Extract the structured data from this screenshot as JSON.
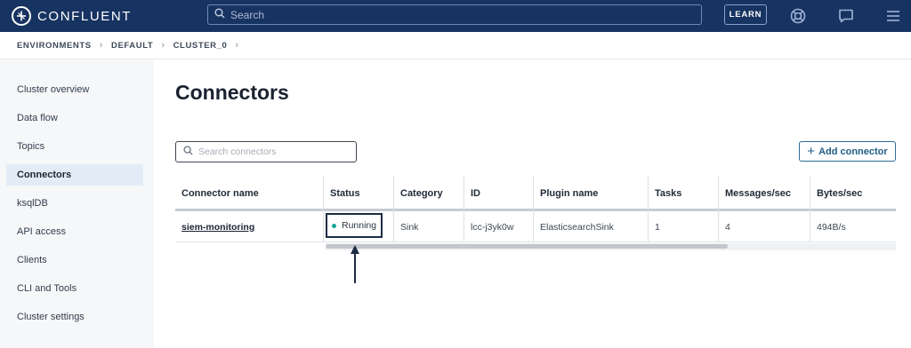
{
  "app": {
    "brand": "CONFLUENT",
    "search_placeholder": "Search",
    "learn_label": "LEARN"
  },
  "breadcrumb": [
    "ENVIRONMENTS",
    "DEFAULT",
    "CLUSTER_0"
  ],
  "sidebar": {
    "items": [
      {
        "label": "Cluster overview"
      },
      {
        "label": "Data flow"
      },
      {
        "label": "Topics"
      },
      {
        "label": "Connectors",
        "active": true
      },
      {
        "label": "ksqlDB"
      },
      {
        "label": "API access"
      },
      {
        "label": "Clients"
      },
      {
        "label": "CLI and Tools"
      },
      {
        "label": "Cluster settings"
      }
    ]
  },
  "main": {
    "title": "Connectors",
    "search_placeholder": "Search connectors",
    "add_label": "Add connector"
  },
  "table": {
    "columns": [
      "Connector name",
      "Status",
      "Category",
      "ID",
      "Plugin name",
      "Tasks",
      "Messages/sec",
      "Bytes/sec"
    ],
    "rows": [
      {
        "name": "siem-monitoring",
        "status": "Running",
        "category": "Sink",
        "id": "lcc-j3yk0w",
        "plugin": "ElasticsearchSink",
        "tasks": "1",
        "messages": "4",
        "bytes": "494B/s"
      }
    ]
  },
  "colors": {
    "topbar": "#173361",
    "status_running": "#1aa39a",
    "accent": "#1f5d86"
  },
  "icons": [
    "confluent-logo-icon",
    "search-icon",
    "help-lifebuoy-icon",
    "chat-icon",
    "menu-icon",
    "plus-icon",
    "status-dot-icon",
    "annotation-arrow-icon"
  ]
}
